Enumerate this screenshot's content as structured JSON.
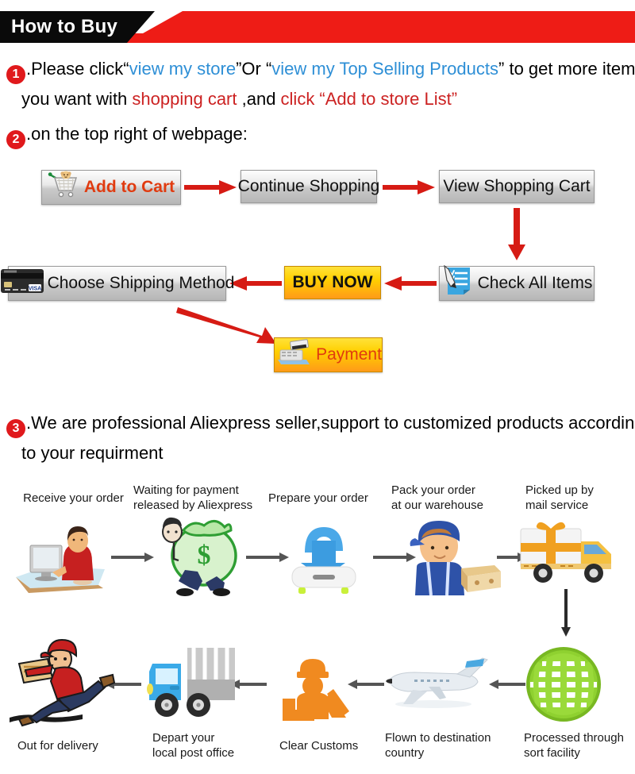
{
  "header": {
    "title": "How to Buy",
    "black_color": "#0a0a0a",
    "red_color": "#ee1c16"
  },
  "steps": [
    {
      "number": "1",
      "line1": {
        "parts": [
          {
            "text": ".Please click“",
            "style": "black"
          },
          {
            "text": "view my store",
            "style": "blue"
          },
          {
            "text": "”Or “",
            "style": "black"
          },
          {
            "text": "view my Top Selling Products",
            "style": "blue"
          },
          {
            "text": "” to get more item",
            "style": "black"
          }
        ]
      },
      "line2": {
        "parts": [
          {
            "text": "you want with ",
            "style": "black"
          },
          {
            "text": "shopping cart",
            "style": "red"
          },
          {
            "text": " ,and ",
            "style": "black"
          },
          {
            "text": "click “Add to store List”",
            "style": "red"
          }
        ]
      }
    },
    {
      "number": "2",
      "line1": {
        "parts": [
          {
            "text": ".on the top right of webpage:",
            "style": "black"
          }
        ]
      }
    },
    {
      "number": "3",
      "line1": {
        "parts": [
          {
            "text": ".We are professional Aliexpress seller,support to customized products accordin",
            "style": "black"
          }
        ]
      },
      "line2": {
        "parts": [
          {
            "text": "to your requirment",
            "style": "black"
          }
        ]
      }
    }
  ],
  "flow_buttons": {
    "add_to_cart": "Add to Cart",
    "continue_shopping": "Continue Shopping",
    "view_shopping_cart": "View Shopping Cart",
    "check_all_items": "Check All Items",
    "buy_now": "BUY NOW",
    "choose_shipping_method": "Choose Shipping Method",
    "payment": "Payment"
  },
  "flow_icons": {
    "add_to_cart": "shopping-cart-icon",
    "check_all_items": "checklist-pen-icon",
    "choose_shipping_method": "credit-card-icon",
    "payment": "cash-register-icon"
  },
  "flow_arrows": [
    {
      "name": "arrow-cart-to-continue",
      "direction": "right"
    },
    {
      "name": "arrow-continue-to-viewcart",
      "direction": "right"
    },
    {
      "name": "arrow-viewcart-to-check",
      "direction": "down"
    },
    {
      "name": "arrow-check-to-buynow",
      "direction": "left"
    },
    {
      "name": "arrow-buynow-to-shipping",
      "direction": "left"
    },
    {
      "name": "arrow-shipping-to-payment",
      "direction": "down-right"
    }
  ],
  "tracking": {
    "row1": [
      {
        "label": "Receive your order",
        "icon": "person-at-computer-icon"
      },
      {
        "label": "Waiting for payment\nreleased by Aliexpress",
        "icon": "money-bag-man-icon"
      },
      {
        "label": "Prepare your order",
        "icon": "download-box-icon"
      },
      {
        "label": "Pack your order\nat our warehouse",
        "icon": "worker-with-boxes-icon"
      },
      {
        "label": "Picked up by\nmail service",
        "icon": "delivery-truck-gift-icon"
      }
    ],
    "row2": [
      {
        "label": "Out for delivery",
        "icon": "running-courier-icon"
      },
      {
        "label": "Depart your\nlocal post office",
        "icon": "blue-post-truck-icon"
      },
      {
        "label": "Clear Customs",
        "icon": "customs-officer-icon"
      },
      {
        "label": "Flown to destination\ncountry",
        "icon": "airplane-icon"
      },
      {
        "label": "Processed through\nsort facility",
        "icon": "green-globe-icon"
      }
    ]
  },
  "colors": {
    "arrow_red": "#d61b14",
    "arrow_gray": "#555555",
    "link_blue": "#2e8fd6",
    "emphasis_red": "#cc2222",
    "step_badge": "#e0191c",
    "gold_start": "#ffe23a",
    "gold_end": "#ff9a18"
  }
}
